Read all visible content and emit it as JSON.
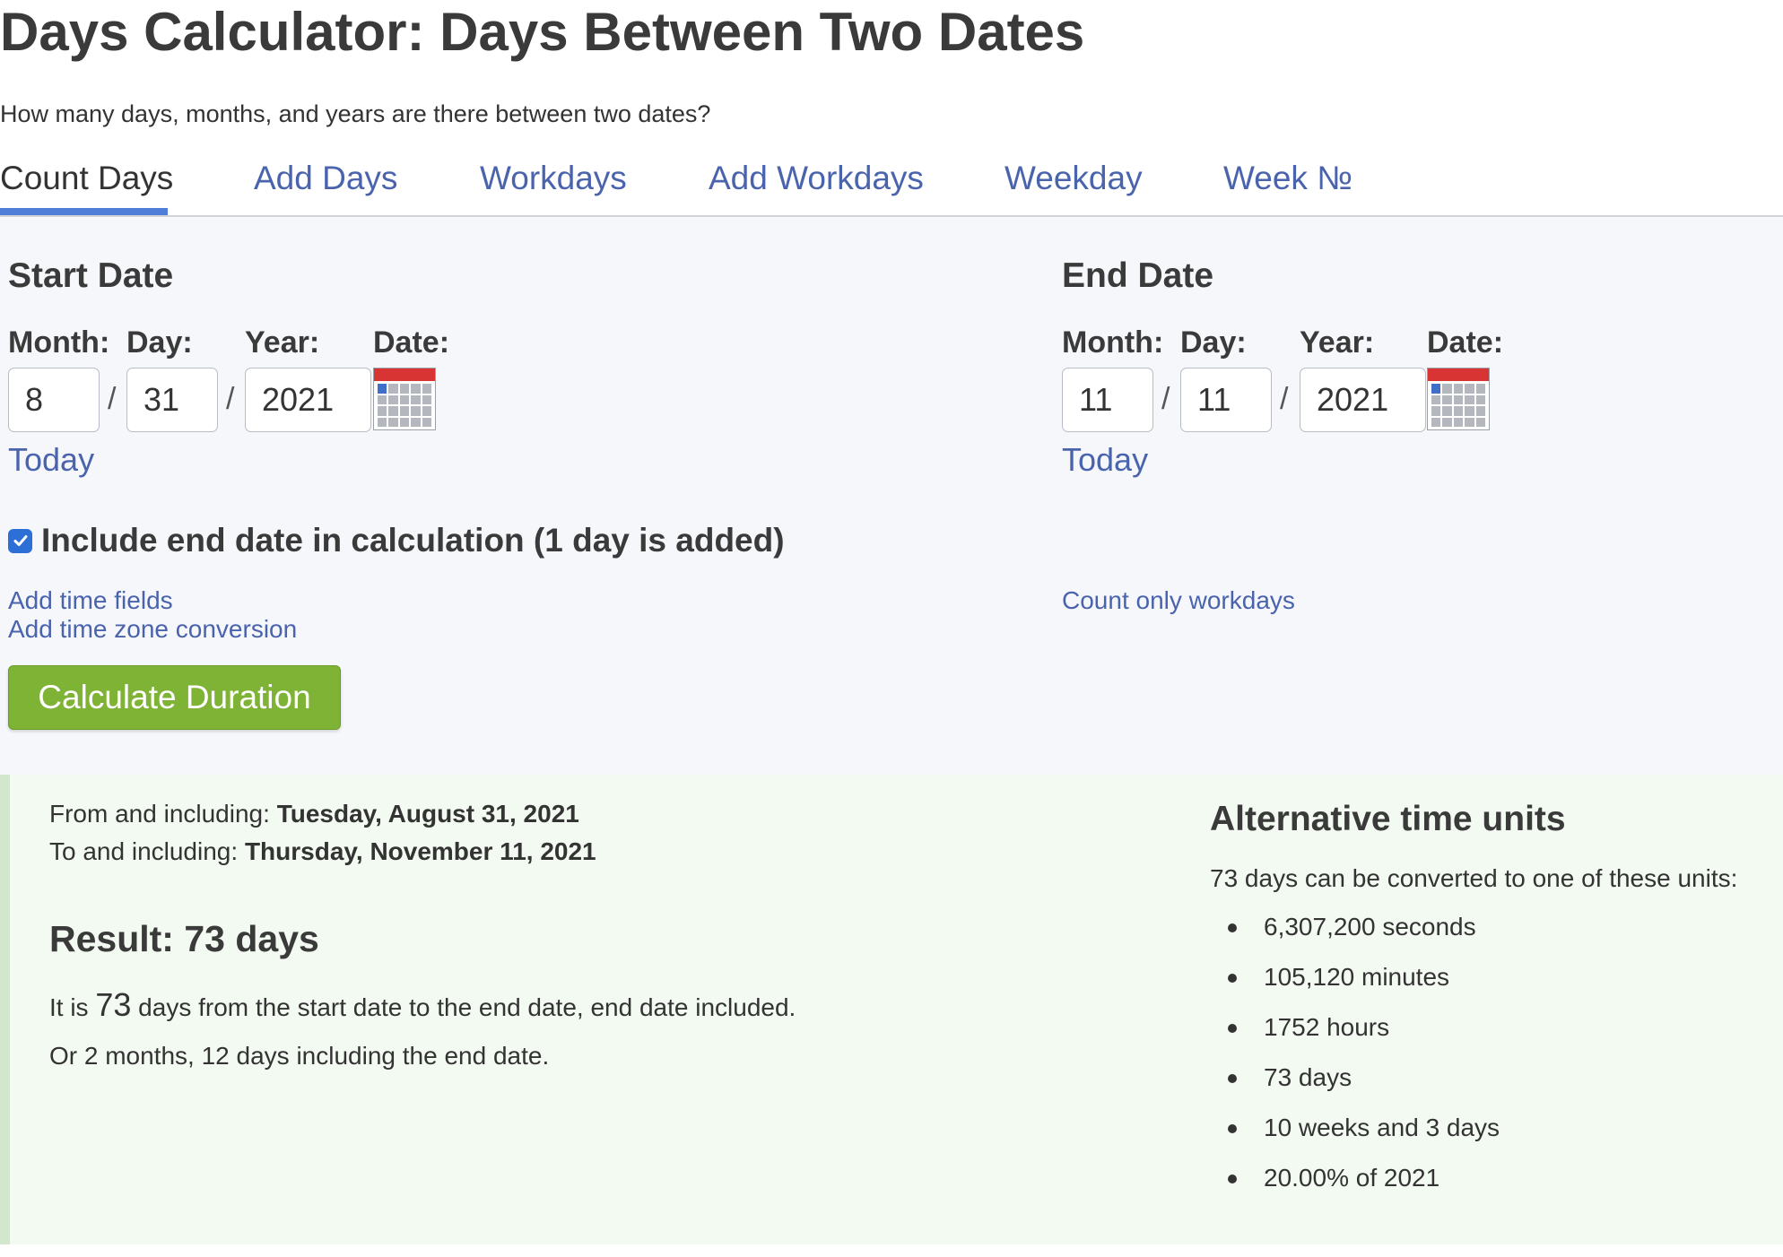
{
  "page": {
    "title": "Days Calculator: Days Between Two Dates",
    "subtitle": "How many days, months, and years are there between two dates?"
  },
  "tabs": [
    {
      "label": "Count Days",
      "active": true
    },
    {
      "label": "Add Days",
      "active": false
    },
    {
      "label": "Workdays",
      "active": false
    },
    {
      "label": "Add Workdays",
      "active": false
    },
    {
      "label": "Weekday",
      "active": false
    },
    {
      "label": "Week №",
      "active": false
    }
  ],
  "form": {
    "start": {
      "heading": "Start Date",
      "month_label": "Month:",
      "day_label": "Day:",
      "year_label": "Year:",
      "date_label": "Date:",
      "month": "8",
      "day": "31",
      "year": "2021",
      "separator": "/",
      "today_link": "Today"
    },
    "end": {
      "heading": "End Date",
      "month_label": "Month:",
      "day_label": "Day:",
      "year_label": "Year:",
      "date_label": "Date:",
      "month": "11",
      "day": "11",
      "year": "2021",
      "separator": "/",
      "today_link": "Today"
    },
    "include_end_date": {
      "checked": true,
      "label": "Include end date in calculation (1 day is added)"
    },
    "links": {
      "add_time_fields": "Add time fields",
      "add_time_zone": "Add time zone conversion",
      "count_only_workdays": "Count only workdays"
    },
    "calculate_button": "Calculate Duration"
  },
  "result": {
    "from_label": "From and including: ",
    "from_value": "Tuesday, August 31, 2021",
    "to_label": "To and including: ",
    "to_value": "Thursday, November 11, 2021",
    "heading": "Result: 73 days",
    "sentence_prefix": "It is ",
    "sentence_number": "73",
    "sentence_suffix": " days from the start date to the end date, end date included.",
    "months_text": "Or 2 months, 12 days including the end date."
  },
  "alternative_units": {
    "heading": "Alternative time units",
    "intro": "73 days can be converted to one of these units:",
    "items": [
      "6,307,200 seconds",
      "105,120 minutes",
      "1752 hours",
      "73 days",
      "10 weeks and 3 days",
      "20.00% of 2021"
    ]
  },
  "colors": {
    "link": "#4a63ad",
    "tab_underline": "#4f7ed9",
    "button": "#7fb335",
    "result_background": "#f3faf1",
    "form_background": "#f5f7fb",
    "checkbox": "#2c6fd6",
    "calendar_header": "#d83434"
  },
  "icons": {
    "date_picker": "calendar-icon",
    "checkbox": "checkmark-icon",
    "list_bullet": "bullet-icon"
  }
}
